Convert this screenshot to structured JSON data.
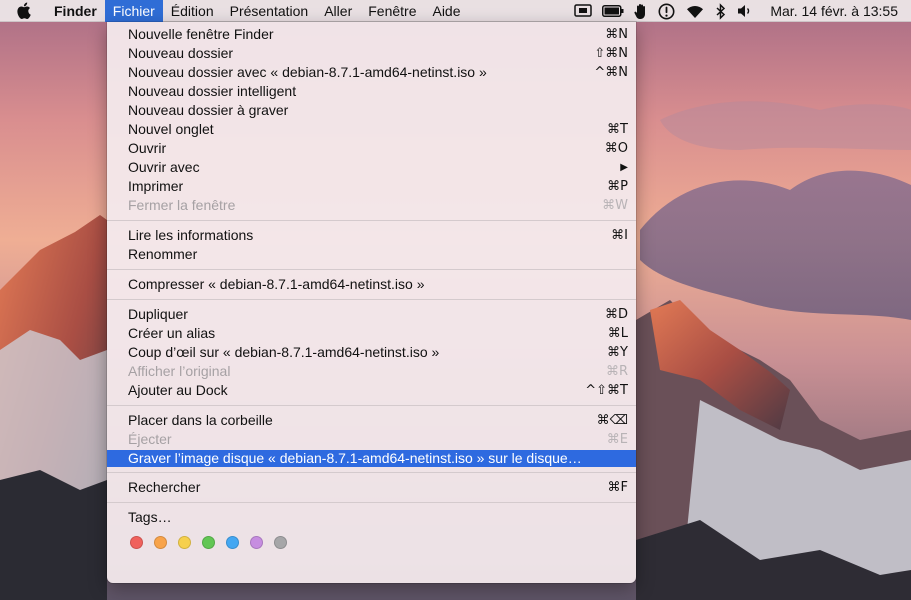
{
  "menubar": {
    "app_name": "Finder",
    "menus": [
      "Fichier",
      "Édition",
      "Présentation",
      "Aller",
      "Fenêtre",
      "Aide"
    ],
    "active_menu": "Fichier",
    "clock": "Mar. 14 févr. à 13:55",
    "status_icons": [
      "screen-mirroring-icon",
      "battery-icon",
      "hand-icon",
      "lock-icon",
      "wifi-icon",
      "bluetooth-icon",
      "volume-icon"
    ]
  },
  "file_menu": {
    "groups": [
      [
        {
          "label": "Nouvelle fenêtre Finder",
          "shortcut": "⌘N",
          "disabled": false
        },
        {
          "label": "Nouveau dossier",
          "shortcut": "⇧⌘N",
          "disabled": false
        },
        {
          "label": "Nouveau dossier avec « debian-8.7.1-amd64-netinst.iso »",
          "shortcut": "^⌘N",
          "disabled": false
        },
        {
          "label": "Nouveau dossier intelligent",
          "shortcut": "",
          "disabled": false
        },
        {
          "label": "Nouveau dossier à graver",
          "shortcut": "",
          "disabled": false
        },
        {
          "label": "Nouvel onglet",
          "shortcut": "⌘T",
          "disabled": false
        },
        {
          "label": "Ouvrir",
          "shortcut": "⌘O",
          "disabled": false
        },
        {
          "label": "Ouvrir avec",
          "shortcut": "▶",
          "disabled": false
        },
        {
          "label": "Imprimer",
          "shortcut": "⌘P",
          "disabled": false
        },
        {
          "label": "Fermer la fenêtre",
          "shortcut": "⌘W",
          "disabled": true
        }
      ],
      [
        {
          "label": "Lire les informations",
          "shortcut": "⌘I",
          "disabled": false
        },
        {
          "label": "Renommer",
          "shortcut": "",
          "disabled": false
        }
      ],
      [
        {
          "label": "Compresser « debian-8.7.1-amd64-netinst.iso »",
          "shortcut": "",
          "disabled": false
        }
      ],
      [
        {
          "label": "Dupliquer",
          "shortcut": "⌘D",
          "disabled": false
        },
        {
          "label": "Créer un alias",
          "shortcut": "⌘L",
          "disabled": false
        },
        {
          "label": "Coup d’œil sur « debian-8.7.1-amd64-netinst.iso »",
          "shortcut": "⌘Y",
          "disabled": false
        },
        {
          "label": "Afficher l’original",
          "shortcut": "⌘R",
          "disabled": true
        },
        {
          "label": "Ajouter au Dock",
          "shortcut": "^⇧⌘T",
          "disabled": false
        }
      ],
      [
        {
          "label": "Placer dans la corbeille",
          "shortcut": "⌘⌫",
          "disabled": false
        },
        {
          "label": "Éjecter",
          "shortcut": "⌘E",
          "disabled": true
        },
        {
          "label": "Graver l’image disque « debian-8.7.1-amd64-netinst.iso » sur le disque…",
          "shortcut": "",
          "disabled": false,
          "selected": true
        }
      ],
      [
        {
          "label": "Rechercher",
          "shortcut": "⌘F",
          "disabled": false
        }
      ],
      [
        {
          "label": "Tags…",
          "shortcut": "",
          "disabled": false
        }
      ]
    ],
    "tag_colors": [
      {
        "name": "red",
        "color": "#f0615c"
      },
      {
        "name": "orange",
        "color": "#f8a34a"
      },
      {
        "name": "yellow",
        "color": "#f6d04d"
      },
      {
        "name": "green",
        "color": "#62c654"
      },
      {
        "name": "blue",
        "color": "#44a7f2"
      },
      {
        "name": "purple",
        "color": "#c68de0"
      },
      {
        "name": "gray",
        "color": "#a6a6a8"
      }
    ]
  }
}
